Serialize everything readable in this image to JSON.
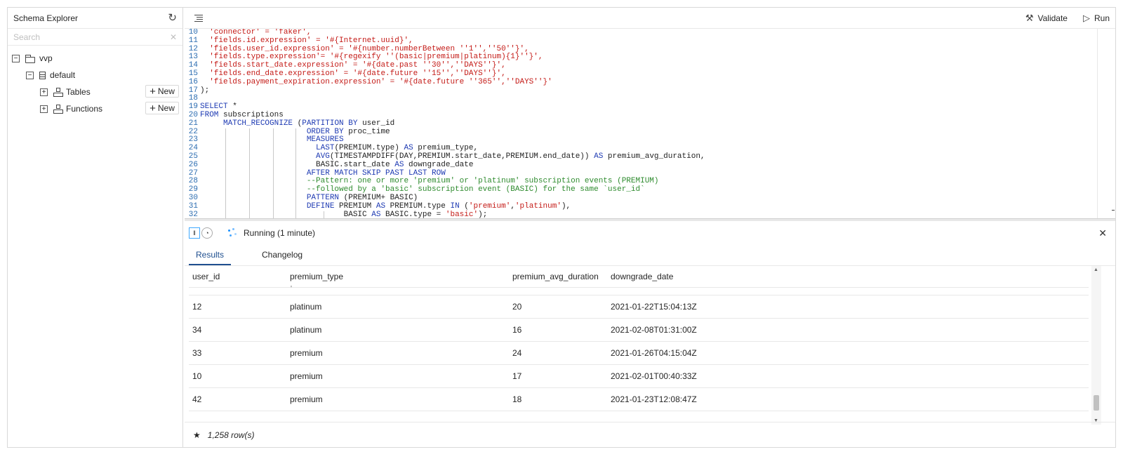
{
  "sidebar": {
    "title": "Schema Explorer",
    "refresh_icon": "refresh-icon",
    "search_placeholder": "Search",
    "clear_glyph": "✕",
    "tree": {
      "root": {
        "toggle": "−",
        "label": "vvp"
      },
      "database": {
        "toggle": "−",
        "label": "default"
      },
      "items": [
        {
          "toggle": "+",
          "label": "Tables",
          "new_label": "New"
        },
        {
          "toggle": "+",
          "label": "Functions",
          "new_label": "New"
        }
      ]
    }
  },
  "toolbar": {
    "validate_label": "Validate",
    "run_label": "Run"
  },
  "editor": {
    "lines": [
      {
        "n": "10",
        "parts": [
          [
            "str",
            "  'connector' = 'faker',"
          ]
        ]
      },
      {
        "n": "11",
        "parts": [
          [
            "str",
            "  'fields.id.expression' = '#{Internet.uuid}',"
          ]
        ]
      },
      {
        "n": "12",
        "parts": [
          [
            "str",
            "  'fields.user_id.expression' = '#{number.numberBetween ''1'',''50''}',"
          ]
        ]
      },
      {
        "n": "13",
        "parts": [
          [
            "str",
            "  'fields.type.expression'= '#{regexify ''(basic|premium|platinum){1}''}',"
          ]
        ]
      },
      {
        "n": "14",
        "parts": [
          [
            "str",
            "  'fields.start_date.expression' = '#{date.past ''30'',''DAYS''}',"
          ]
        ]
      },
      {
        "n": "15",
        "parts": [
          [
            "str",
            "  'fields.end_date.expression' = '#{date.future ''15'',''DAYS''}',"
          ]
        ]
      },
      {
        "n": "16",
        "parts": [
          [
            "str",
            "  'fields.payment_expiration.expression' = '#{date.future ''365'',''DAYS''}'"
          ]
        ]
      },
      {
        "n": "17",
        "parts": [
          [
            "ct",
            ");"
          ]
        ]
      },
      {
        "n": "18",
        "parts": []
      },
      {
        "n": "19",
        "parts": [
          [
            "kw",
            "SELECT"
          ],
          [
            "ct",
            " *"
          ]
        ]
      },
      {
        "n": "20",
        "parts": [
          [
            "kw",
            "FROM"
          ],
          [
            "ct",
            " subscriptions"
          ]
        ]
      },
      {
        "n": "21",
        "parts": [
          [
            "ct",
            "     "
          ],
          [
            "kw",
            "MATCH_RECOGNIZE"
          ],
          [
            "ct",
            " ("
          ],
          [
            "kw",
            "PARTITION BY"
          ],
          [
            "ct",
            " user_id"
          ]
        ]
      },
      {
        "n": "22",
        "parts": [
          [
            "ct",
            "                       "
          ],
          [
            "kw",
            "ORDER BY"
          ],
          [
            "ct",
            " proc_time"
          ]
        ]
      },
      {
        "n": "23",
        "parts": [
          [
            "ct",
            "                       "
          ],
          [
            "kw",
            "MEASURES"
          ]
        ]
      },
      {
        "n": "24",
        "parts": [
          [
            "ct",
            "                         "
          ],
          [
            "fn",
            "LAST"
          ],
          [
            "ct",
            "(PREMIUM.type) "
          ],
          [
            "kw",
            "AS"
          ],
          [
            "ct",
            " premium_type,"
          ]
        ]
      },
      {
        "n": "25",
        "parts": [
          [
            "ct",
            "                         "
          ],
          [
            "fn",
            "AVG"
          ],
          [
            "ct",
            "(TIMESTAMPDIFF(DAY,PREMIUM.start_date,PREMIUM.end_date)) "
          ],
          [
            "kw",
            "AS"
          ],
          [
            "ct",
            " premium_avg_duration,"
          ]
        ]
      },
      {
        "n": "26",
        "parts": [
          [
            "ct",
            "                         BASIC.start_date "
          ],
          [
            "kw",
            "AS"
          ],
          [
            "ct",
            " downgrade_date"
          ]
        ]
      },
      {
        "n": "27",
        "parts": [
          [
            "ct",
            "                       "
          ],
          [
            "kw",
            "AFTER MATCH SKIP PAST LAST ROW"
          ]
        ]
      },
      {
        "n": "28",
        "parts": [
          [
            "ct",
            "                       "
          ],
          [
            "cmt",
            "--Pattern: one or more 'premium' or 'platinum' subscription events (PREMIUM)"
          ]
        ]
      },
      {
        "n": "29",
        "parts": [
          [
            "ct",
            "                       "
          ],
          [
            "cmt",
            "--followed by a 'basic' subscription event (BASIC) for the same `user_id`"
          ]
        ]
      },
      {
        "n": "30",
        "parts": [
          [
            "ct",
            "                       "
          ],
          [
            "kw",
            "PATTERN"
          ],
          [
            "ct",
            " (PREMIUM+ BASIC)"
          ]
        ]
      },
      {
        "n": "31",
        "parts": [
          [
            "ct",
            "                       "
          ],
          [
            "kw",
            "DEFINE"
          ],
          [
            "ct",
            " PREMIUM "
          ],
          [
            "kw",
            "AS"
          ],
          [
            "ct",
            " PREMIUM.type "
          ],
          [
            "kw",
            "IN"
          ],
          [
            "ct",
            " ("
          ],
          [
            "str",
            "'premium'"
          ],
          [
            "ct",
            ","
          ],
          [
            "str",
            "'platinum'"
          ],
          [
            "ct",
            "),"
          ]
        ]
      },
      {
        "n": "32",
        "parts": [
          [
            "ct",
            "                               BASIC "
          ],
          [
            "kw",
            "AS"
          ],
          [
            "ct",
            " BASIC.type = "
          ],
          [
            "str",
            "'basic'"
          ],
          [
            "ct",
            ");"
          ]
        ]
      }
    ]
  },
  "results": {
    "status": "Running (1 minute)",
    "tabs": [
      {
        "label": "Results",
        "active": true
      },
      {
        "label": "Changelog",
        "active": false
      }
    ],
    "columns": [
      "user_id",
      "premium_type",
      "premium_avg_duration",
      "downgrade_date"
    ],
    "rows": [
      [
        "12",
        "platinum",
        "20",
        "2021-01-22T15:04:13Z"
      ],
      [
        "34",
        "platinum",
        "16",
        "2021-02-08T01:31:00Z"
      ],
      [
        "33",
        "premium",
        "24",
        "2021-01-26T04:15:04Z"
      ],
      [
        "10",
        "premium",
        "17",
        "2021-02-01T00:40:33Z"
      ],
      [
        "42",
        "premium",
        "18",
        "2021-01-23T12:08:47Z"
      ]
    ],
    "row_count": "1,258 row(s)"
  }
}
